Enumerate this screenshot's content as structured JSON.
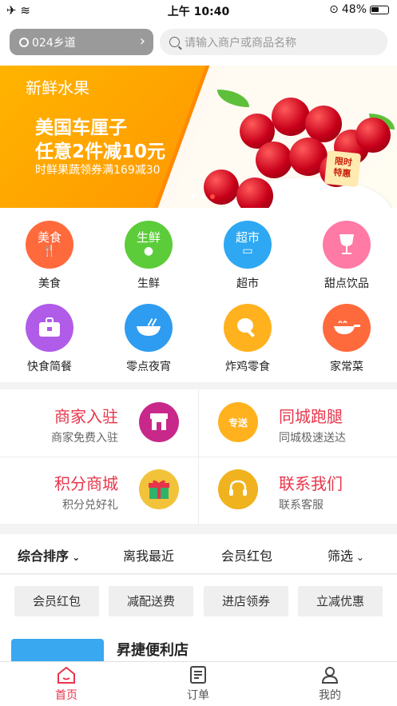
{
  "status_bar": {
    "left_icons": "✈ ≋",
    "time": "上午 10:40",
    "battery": "48%"
  },
  "header": {
    "location": "024乡道",
    "search_placeholder": "请输入商户或商品名称"
  },
  "banner": {
    "tag": "新鲜水果",
    "headline_1": "美国车厘子",
    "headline_2": "任意2件减10元",
    "subline": "时鲜果蔬领券满169减30",
    "badge_1": "限时",
    "badge_2": "特惠",
    "colors": {
      "bg": "#ffa800",
      "accent": "#ff4d3d"
    }
  },
  "categories": [
    {
      "label": "美食",
      "icon_text": "美食",
      "icon": "food-icon",
      "color": "#ff6a3d"
    },
    {
      "label": "生鲜",
      "icon_text": "生鲜",
      "icon": "apple-icon",
      "color": "#5ccc3a"
    },
    {
      "label": "超市",
      "icon_text": "超市",
      "icon": "basket-icon",
      "color": "#2ea8f2"
    },
    {
      "label": "甜点饮品",
      "icon_text": "",
      "icon": "wine-glass-icon",
      "color": "#ff7aa5"
    },
    {
      "label": "快食简餐",
      "icon_text": "",
      "icon": "bento-icon",
      "color": "#b05ce8"
    },
    {
      "label": "零点夜宵",
      "icon_text": "",
      "icon": "bowl-icon",
      "color": "#2e9cf0"
    },
    {
      "label": "炸鸡零食",
      "icon_text": "",
      "icon": "drumstick-icon",
      "color": "#ffb21e"
    },
    {
      "label": "家常菜",
      "icon_text": "",
      "icon": "pan-icon",
      "color": "#ff6a3d"
    }
  ],
  "services": [
    {
      "title": "商家入驻",
      "sub": "商家免费入驻",
      "icon": "shop-icon",
      "color": "#c8288a"
    },
    {
      "title": "同城跑腿",
      "sub": "同城极速送达",
      "icon": "delivery-icon",
      "icon_text": "专送",
      "color": "#ffb21e"
    },
    {
      "title": "积分商城",
      "sub": "积分兑好礼",
      "icon": "gift-icon",
      "color": "#f2c33a"
    },
    {
      "title": "联系我们",
      "sub": "联系客服",
      "icon": "headset-icon",
      "color": "#f0b21e"
    }
  ],
  "sort_bar": {
    "items": [
      "综合排序",
      "离我最近",
      "会员红包",
      "筛选"
    ]
  },
  "filters": [
    "会员红包",
    "减配送费",
    "进店领券",
    "立减优惠"
  ],
  "store": {
    "name": "昇捷便利店"
  },
  "tabbar": {
    "tabs": [
      "首页",
      "订单",
      "我的"
    ],
    "active_color": "#e8344a"
  }
}
